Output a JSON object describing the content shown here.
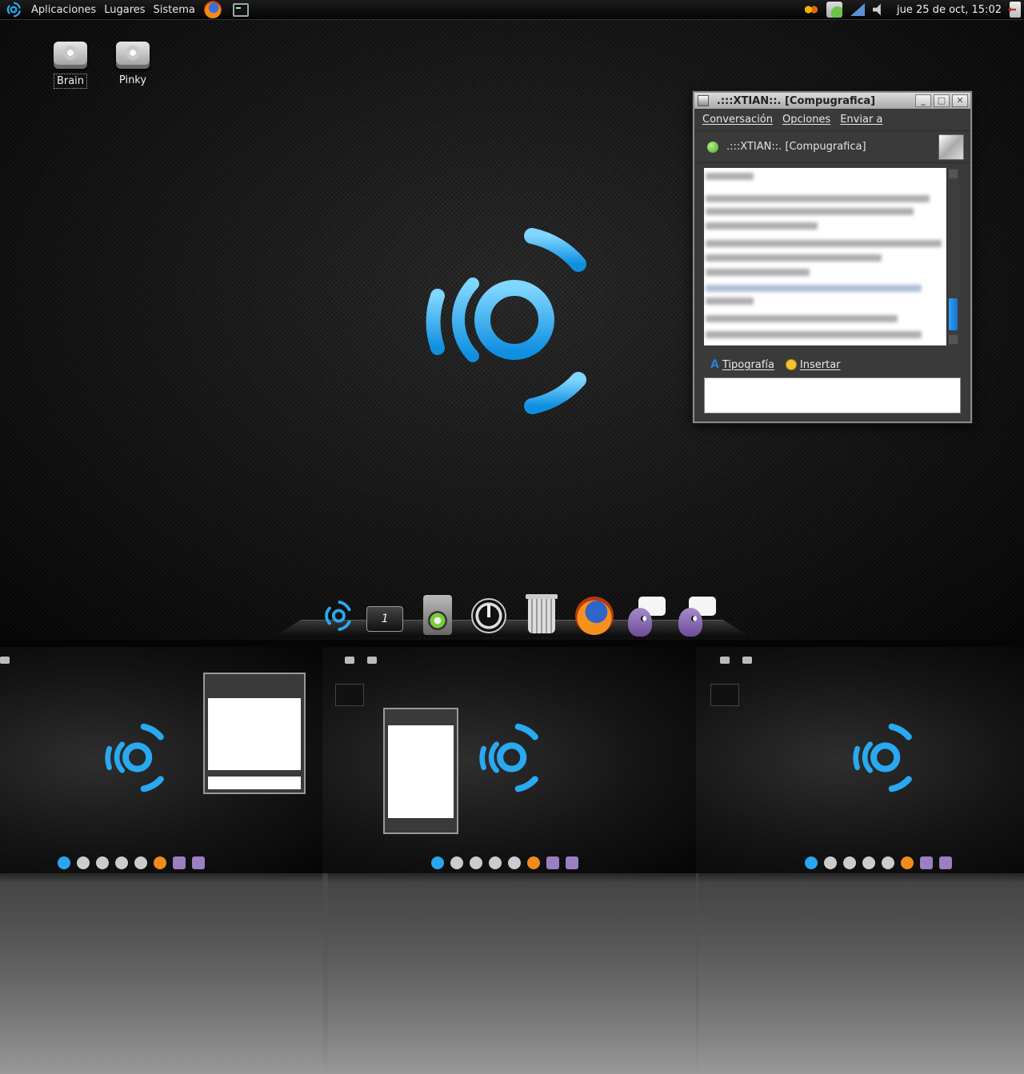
{
  "panel": {
    "menus": [
      "Aplicaciones",
      "Lugares",
      "Sistema"
    ],
    "clock": "jue 25 de oct, 15:02"
  },
  "desktop": {
    "icons": [
      {
        "label": "Brain",
        "icon": "drive-icon"
      },
      {
        "label": "Pinky",
        "icon": "drive-icon"
      }
    ]
  },
  "chat": {
    "window_title": ".:::XTIAN::. [Compugrafica]",
    "menu": [
      "Conversación",
      "Opciones",
      "Enviar a"
    ],
    "buddy_name": ".:::XTIAN::. [Compugrafica]",
    "toolbar": {
      "font_label": "Tipografía",
      "insert_label": "Insertar"
    }
  },
  "dock": {
    "items": [
      "xubuntu-logo-icon",
      "workspace-switcher-icon",
      "speaker-icon",
      "power-icon",
      "trash-icon",
      "firefox-icon",
      "pidgin-icon",
      "pidgin-icon"
    ],
    "workspace_number": "1"
  },
  "colors": {
    "accent": "#29a9f0",
    "panel_bg": "#0a0a0a",
    "status_online": "#4caa1a"
  }
}
